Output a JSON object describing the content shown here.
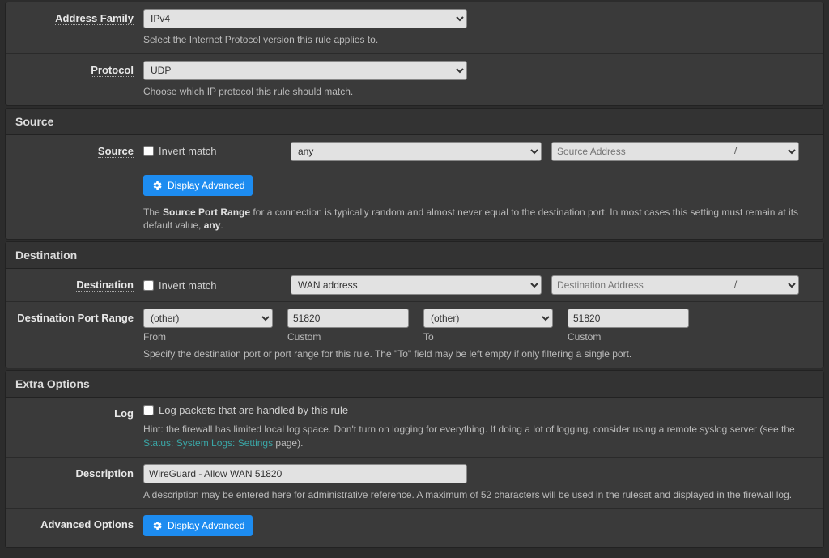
{
  "address_family": {
    "label": "Address Family",
    "value": "IPv4",
    "help": "Select the Internet Protocol version this rule applies to."
  },
  "protocol": {
    "label": "Protocol",
    "value": "UDP",
    "help": "Choose which IP protocol this rule should match."
  },
  "source_section": {
    "title": "Source",
    "label": "Source",
    "invert_label": "Invert match",
    "invert_checked": false,
    "type_value": "any",
    "address_placeholder": "Source Address",
    "address_value": "",
    "mask_sep": "/",
    "mask_value": "",
    "btn_label": "Display Advanced",
    "help_prefix": "The ",
    "help_bold1": "Source Port Range",
    "help_mid": " for a connection is typically random and almost never equal to the destination port. In most cases this setting must remain at its default value, ",
    "help_bold2": "any",
    "help_suffix": "."
  },
  "destination_section": {
    "title": "Destination",
    "label": "Destination",
    "invert_label": "Invert match",
    "invert_checked": false,
    "type_value": "WAN address",
    "address_placeholder": "Destination Address",
    "address_value": "",
    "mask_sep": "/",
    "mask_value": "",
    "portrange_label": "Destination Port Range",
    "from_select": "(other)",
    "from_custom": "51820",
    "to_select": "(other)",
    "to_custom": "51820",
    "from_label": "From",
    "custom_label": "Custom",
    "to_label": "To",
    "help": "Specify the destination port or port range for this rule. The \"To\" field may be left empty if only filtering a single port."
  },
  "extra_section": {
    "title": "Extra Options",
    "log_label": "Log",
    "log_check_label": "Log packets that are handled by this rule",
    "log_checked": false,
    "log_help_prefix": "Hint: the firewall has limited local log space. Don't turn on logging for everything. If doing a lot of logging, consider using a remote syslog server (see the ",
    "log_help_link": "Status: System Logs: Settings",
    "log_help_suffix": " page).",
    "desc_label": "Description",
    "desc_value": "WireGuard - Allow WAN 51820",
    "desc_help": "A description may be entered here for administrative reference. A maximum of 52 characters will be used in the ruleset and displayed in the firewall log.",
    "adv_label": "Advanced Options",
    "adv_btn_label": "Display Advanced"
  }
}
